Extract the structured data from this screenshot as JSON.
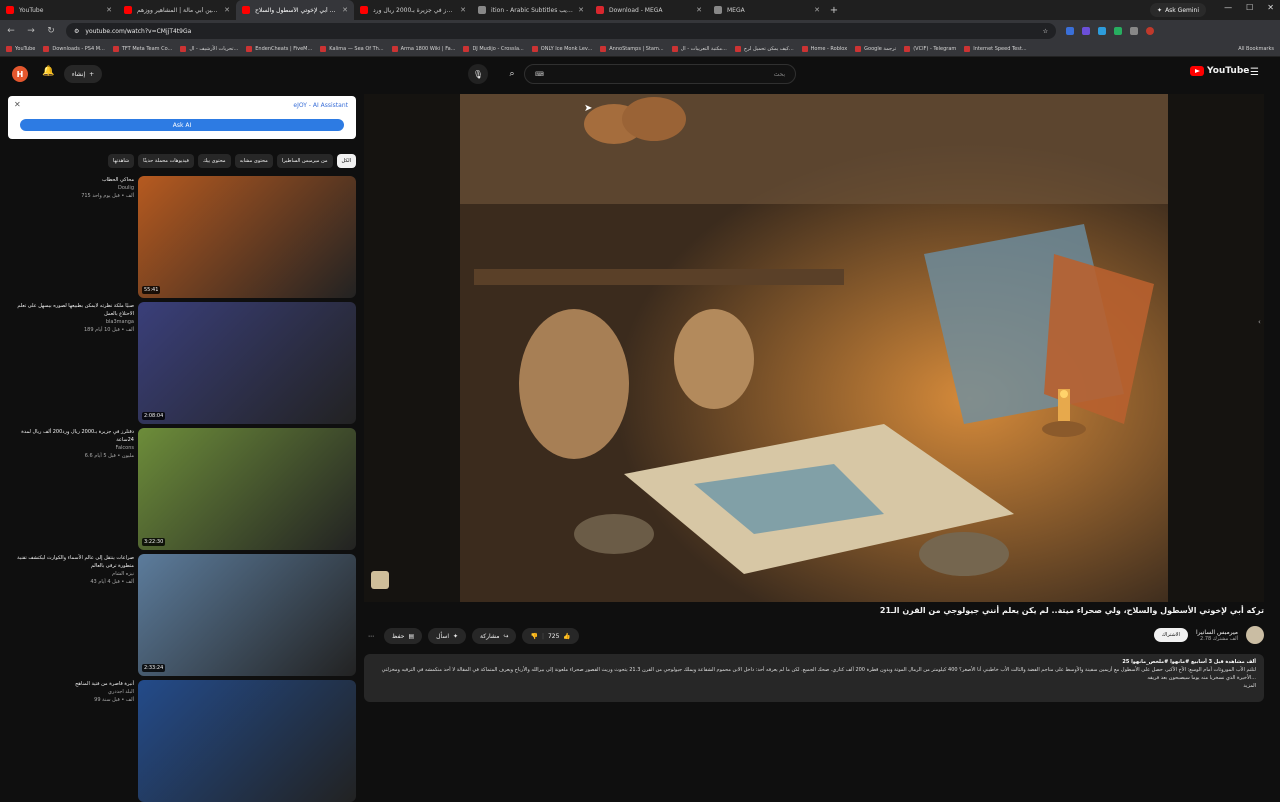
{
  "browser": {
    "tabs": [
      {
        "label": "YouTube",
        "color": "#ff0000",
        "active": false
      },
      {
        "label": "تحسين أبي مالة | المشاهير ووزهم",
        "color": "#ff0000",
        "active": false
      },
      {
        "label": "تركه أبي لإخوتي الأسطول والسلاح...",
        "color": "#ff0000",
        "active": true
      },
      {
        "label": "دقتلرز في جزيرة بـ2000 ريال ورد...",
        "color": "#ff0000",
        "active": false
      },
      {
        "label": "ition - Arabic Subtitles تعريب",
        "color": "#888888",
        "active": false
      },
      {
        "label": "Download - MEGA",
        "color": "#d9272e",
        "active": false
      },
      {
        "label": "MEGA",
        "color": "#888888",
        "active": false
      }
    ],
    "gemini_label": "Ask Gemini",
    "url": "youtube.com/watch?v=CMjjT4t9Ga",
    "bookmarks": [
      "YouTube",
      "Downloads - PS4 M...",
      "TFT Meta Team Co...",
      "تحريات الأرشيف - ال...",
      "EndenCheats | FiveM...",
      "Kalima — Sea Of Th...",
      "Arma 1800 Wiki | Fa...",
      "DJ Mudijo - Crossla...",
      "ONLY Ice Monk Lev...",
      "AnnoStamps | Stam...",
      "مكتبة التعريبات - ال...",
      "كيف يمكن تحميل لرج...",
      "Home - Roblox",
      "Google ترجمة",
      "(VCIF) - Telegram",
      "Internet Speed Test..."
    ],
    "bookmarks_right": "All Bookmarks"
  },
  "header": {
    "avatar_letter": "H",
    "create_label": "إنشاء",
    "search_placeholder": "بحث",
    "logo_text": "YouTube"
  },
  "ejoy": {
    "brand": "eJOY - AI Assistant",
    "ask_label": "Ask AI"
  },
  "chips": [
    "الكل",
    "من ميرمبس الساطيرا",
    "محتوى مشابه",
    "محتوى ييك",
    "فيديوهات محملة حديثًا",
    "شاهدتها"
  ],
  "recommendations": [
    {
      "title": "محاكي الحطاب",
      "channel": "Doulig",
      "stats": "715 ألف • قبل يوم واحد",
      "duration": "55:41",
      "color": "#b65a20"
    },
    {
      "title": "صبيًا ملكة نظرته لايمكن بطبيعها لصوره بيسهل على تعلم الاحتلاع بالعمل",
      "channel": "bla3manga",
      "stats": "189 ألف • قبل 10 أيام",
      "duration": "2:08:04",
      "color": "#3a3f7a"
    },
    {
      "title": "دقتلرز في جزيرة بـ2000 ريال ورد200 ألف ريال لمدة 24ساعة",
      "channel": "Falcons",
      "stats": "6.6 مليون • قبل 5 أيام",
      "duration": "3:22:30",
      "color": "#6d8d3a"
    },
    {
      "title": "صراعات ينتقل إلى عالم الأسماء والكوارث ليكتشف تقنية متطورة ترقى بالعالم",
      "channel": "نيزه الشام",
      "stats": "43 ألف • قبل 4 أيام",
      "duration": "2:33:24",
      "color": "#5c7c9c"
    },
    {
      "title": "أنبرة قاصرة من فتية المناهج",
      "channel": "البلد اجددري",
      "stats": "99 ألف • قبل سنة",
      "duration": "",
      "color": "#234b8a"
    }
  ],
  "video": {
    "title": "تركه أبي لإخوتي الأسطول والسلاح، ولي صحراء ميتة.. لم يكن يعلم أنني جيولوجي من القرن الـ21",
    "channel": "ميرمبس السانيرا",
    "subs": "2.78 ألف مشترك",
    "subscribe_label": "الاشتراك",
    "likes": "725",
    "share_label": "مشاركة",
    "ask_label": "اسأل",
    "save_label": "حفظ",
    "views_line": "25 ألف مشاهدة قبل 3 أسابيع #مانهوا #ملخص_مانهوا",
    "description": "لتلتم الأب الموروثات أمام الوسع: الأخ الأكبر، حصل على الأسطول مع أزيمين سفينة والأوسط على مناجم الفضة والثالث الأب خاطبني أنا الأصغر؟ 400 كيلومتر من الرمال الموتة ويدون قطرة 200 ألف كتاري. صحك الجميع. لكن ما لم يعرفه أحد: داخل الابن محموم الشفاعة ويملك جيولوجي من القرن 21.3 يتحوث وريث القصور صحراء ملعونة إلى بيرالله والأرباح ويعرف المتماكة في المقالة لا أحد منكمشه في الترفيه ومخزلتي الأخيرة الذي نسخربا منه يوما سيصبحون بعد فريقه...",
    "more_label": "المزيد"
  },
  "colors": {
    "accent": "#ff0000",
    "background": "#0f0f0f",
    "chip": "#272727"
  }
}
